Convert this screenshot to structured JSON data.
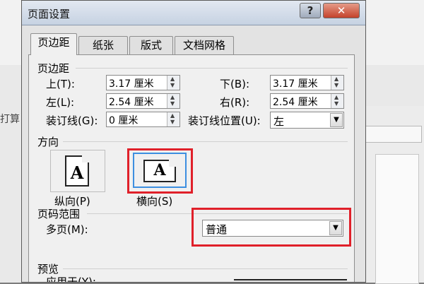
{
  "background": {
    "doc_text": "打算"
  },
  "dialog": {
    "title": "页面设置",
    "help_button": "?",
    "close_button": "✕",
    "tabs": [
      {
        "label": "页边距",
        "active": true
      },
      {
        "label": "纸张",
        "active": false
      },
      {
        "label": "版式",
        "active": false
      },
      {
        "label": "文档网格",
        "active": false
      }
    ],
    "margins": {
      "section_title": "页边距",
      "top_label": "上(T):",
      "top_value": "3.17 厘米",
      "bottom_label": "下(B):",
      "bottom_value": "3.17 厘米",
      "left_label": "左(L):",
      "left_value": "2.54 厘米",
      "right_label": "右(R):",
      "right_value": "2.54 厘米",
      "gutter_label": "装订线(G):",
      "gutter_value": "0 厘米",
      "gutter_pos_label": "装订线位置(U):",
      "gutter_pos_value": "左"
    },
    "orientation": {
      "section_title": "方向",
      "portrait_label": "纵向(P)",
      "landscape_label": "横向(S)",
      "icon_letter": "A",
      "selected": "landscape"
    },
    "pages": {
      "section_title": "页码范围",
      "multiple_label": "多页(M):",
      "multiple_value": "普通"
    },
    "preview": {
      "section_title": "预览",
      "apply_label": "应用于(Y):"
    }
  },
  "colors": {
    "highlight": "#e0202a",
    "selected_border": "#3c8fe0"
  }
}
